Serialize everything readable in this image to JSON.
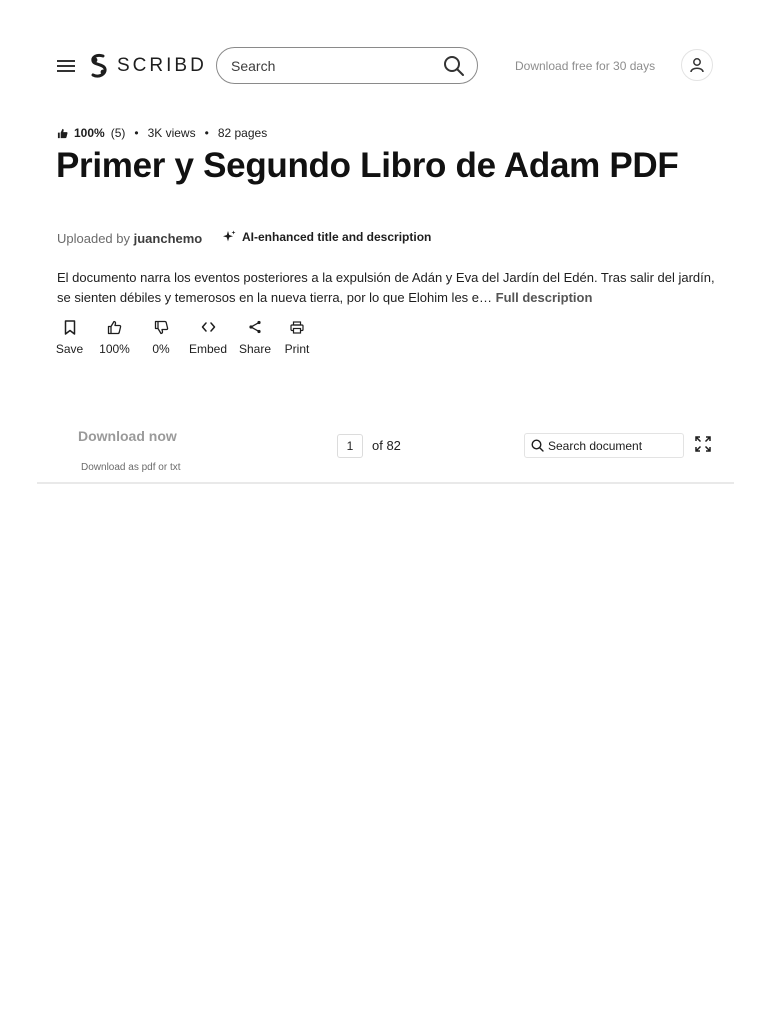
{
  "header": {
    "brand": "SCRIBD",
    "search_placeholder": "Search",
    "download_free": "Download free for 30 days"
  },
  "meta": {
    "rating": "100%",
    "rating_count": "(5)",
    "views": "3K views",
    "pages": "82 pages"
  },
  "document": {
    "title": "Primer y Segundo Libro de Adam PDF",
    "uploaded_by_label": "Uploaded by",
    "uploader": "juanchemo",
    "ai_tag": "AI-enhanced title and description",
    "description": "El documento narra los eventos posteriores a la expulsión de Adán y Eva del Jardín del Edén. Tras salir del jardín, se sienten débiles y temerosos en la nueva tierra, por lo que Elohim les e…",
    "full_description": "Full description"
  },
  "actions": [
    {
      "label": "Save",
      "icon": "bookmark-icon"
    },
    {
      "label": "100%",
      "icon": "thumbs-up-icon"
    },
    {
      "label": "0%",
      "icon": "thumbs-down-icon"
    },
    {
      "label": "Embed",
      "icon": "code-icon"
    },
    {
      "label": "Share",
      "icon": "share-icon"
    },
    {
      "label": "Print",
      "icon": "print-icon"
    }
  ],
  "toolbar": {
    "download_now": "Download now",
    "download_sub": "Download as pdf or txt",
    "page_current": "1",
    "page_of": "of 82",
    "doc_search_placeholder": "Search document"
  },
  "colors": {
    "text": "#1a1a1a",
    "muted": "#8d8d8d",
    "border": "#e3e3e3"
  }
}
